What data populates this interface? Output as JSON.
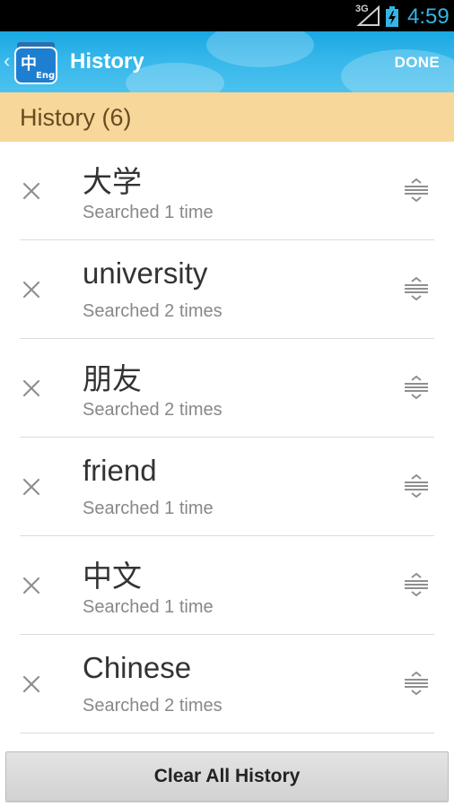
{
  "status_bar": {
    "network": "3G",
    "time": "4:59"
  },
  "action_bar": {
    "title": "History",
    "done_label": "DONE",
    "app_icon_text": "中",
    "app_icon_sub": "Eng"
  },
  "section_header": {
    "title": "History (6)"
  },
  "history": [
    {
      "word": "大学",
      "count": "Searched 1 time"
    },
    {
      "word": "university",
      "count": "Searched 2 times"
    },
    {
      "word": "朋友",
      "count": "Searched 2 times"
    },
    {
      "word": "friend",
      "count": "Searched 1 time"
    },
    {
      "word": "中文",
      "count": "Searched 1 time"
    },
    {
      "word": "Chinese",
      "count": "Searched 2 times"
    }
  ],
  "footer": {
    "clear_label": "Clear All History"
  },
  "colors": {
    "accent": "#33b5e5",
    "action_bar": "#1aa7e3",
    "section_header_bg": "#f8d79a"
  }
}
